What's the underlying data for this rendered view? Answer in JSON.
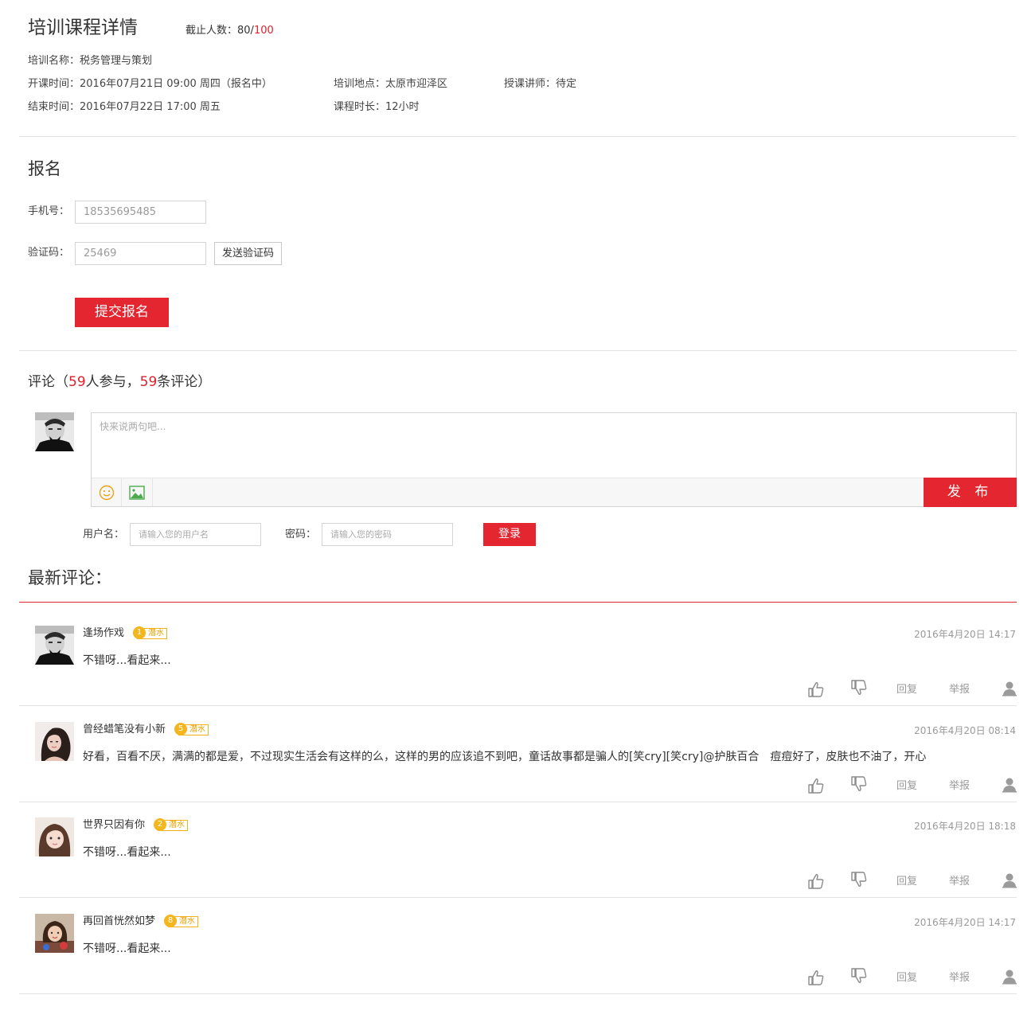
{
  "course": {
    "title": "培训课程详情",
    "quota_label": "截止人数：",
    "quota_current": "80/",
    "quota_total": "100",
    "name": "培训名称：税务管理与策划",
    "start": "开课时间：2016年07月21日 09:00 周四（报名中）",
    "end": "结束时间：2016年07月22日 17:00 周五",
    "location": "培训地点：太原市迎泽区",
    "duration": "课程时长：12小时",
    "teacher": "授课讲师：待定"
  },
  "signup": {
    "heading": "报名",
    "phone_label": "手机号：",
    "phone_value": "18535695485",
    "code_label": "验证码：",
    "code_value": "25469",
    "send_code": "发送验证码",
    "submit": "提交报名"
  },
  "comments_summary": {
    "prefix": "评论（",
    "participants": "59",
    "mid": "人参与，",
    "count": "59",
    "suffix": "条评论）"
  },
  "editor": {
    "placeholder": "快来说两句吧...",
    "publish": "发 布",
    "username_label": "用户名：",
    "username_placeholder": "请输入您的用户名",
    "password_label": "密码：",
    "password_placeholder": "请输入您的密码",
    "login": "登录"
  },
  "latest": {
    "heading": "最新评论：",
    "accent": "#e3262f",
    "actions": {
      "reply": "回复",
      "report": "举报"
    },
    "items": [
      {
        "user": "逢场作戏",
        "level": "1",
        "tag": "潜水",
        "time": "2016年4月20日 14:17",
        "text": "不错呀...看起来..."
      },
      {
        "user": "曾经蜡笔没有小新",
        "level": "5",
        "tag": "潜水",
        "time": "2016年4月20日 08:14",
        "text": "好看，百看不厌，满满的都是爱，不过现实生活会有这样的么，这样的男的应该追不到吧，童话故事都是骗人的[笑cry][笑cry]@护肤百合　痘痘好了，皮肤也不油了，开心"
      },
      {
        "user": "世界只因有你",
        "level": "2",
        "tag": "潜水",
        "time": "2016年4月20日 18:18",
        "text": "不错呀...看起来..."
      },
      {
        "user": "再回首恍然如梦",
        "level": "8",
        "tag": "潜水",
        "time": "2016年4月20日 14:17",
        "text": "不错呀...看起来..."
      }
    ]
  }
}
